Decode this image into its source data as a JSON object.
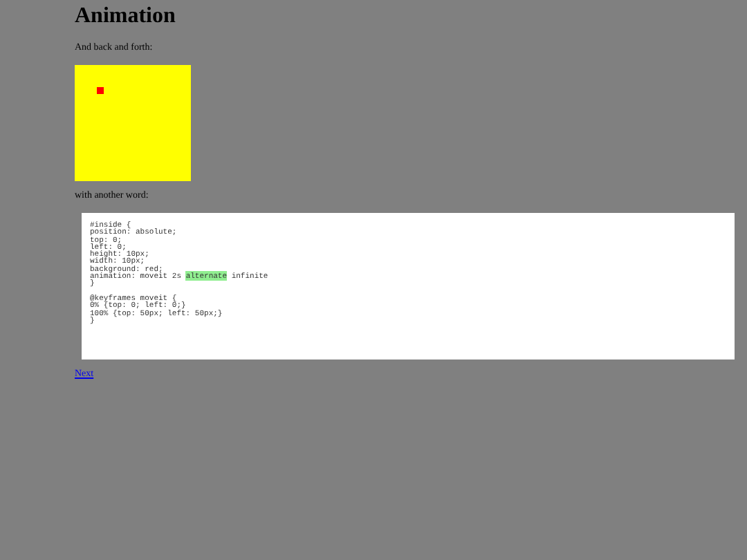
{
  "heading": "Animation",
  "intro": "And back and forth:",
  "caption": "with another word:",
  "code_blocks": [
    [
      [
        {
          "text": "#inside {",
          "highlighted": false
        }
      ],
      [
        {
          "text": "position: absolute;",
          "highlighted": false
        }
      ],
      [
        {
          "text": "top: 0;",
          "highlighted": false
        }
      ],
      [
        {
          "text": "left: 0;",
          "highlighted": false
        }
      ],
      [
        {
          "text": "height: 10px;",
          "highlighted": false
        }
      ],
      [
        {
          "text": "width: 10px;",
          "highlighted": false
        }
      ],
      [
        {
          "text": "background: red;",
          "highlighted": false
        }
      ],
      [
        {
          "text": "animation: moveit 2s ",
          "highlighted": false
        },
        {
          "text": "alternate",
          "highlighted": true
        },
        {
          "text": " infinite",
          "highlighted": false
        }
      ],
      [
        {
          "text": "}",
          "highlighted": false
        }
      ]
    ],
    [
      [
        {
          "text": "@keyframes moveit {",
          "highlighted": false
        }
      ],
      [
        {
          "text": "0% {top: 0; left: 0;}",
          "highlighted": false
        }
      ],
      [
        {
          "text": "100% {top: 50px; left: 50px;}",
          "highlighted": false
        }
      ],
      [
        {
          "text": "}",
          "highlighted": false
        }
      ]
    ]
  ],
  "link": "Next"
}
